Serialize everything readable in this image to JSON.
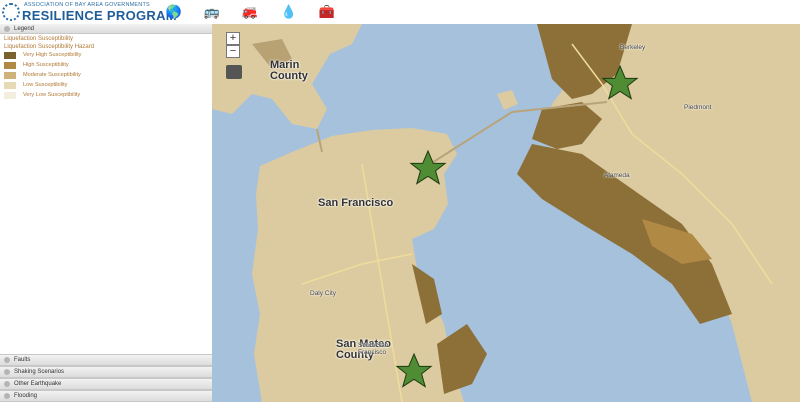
{
  "app": {
    "logo_top": "ASSOCIATION OF BAY AREA GOVERNMENTS",
    "logo_main": "RESILIENCE PROGRAM",
    "tools": [
      {
        "name": "earth-globe-icon",
        "glyph": "🌎"
      },
      {
        "name": "school-bus-icon",
        "glyph": "🚌"
      },
      {
        "name": "fire-truck-icon",
        "glyph": "🚒"
      },
      {
        "name": "water-drop-icon",
        "glyph": "💧"
      },
      {
        "name": "warning-box-icon",
        "glyph": "🧰"
      }
    ]
  },
  "sidebar": {
    "legend_header": "Legend",
    "layer_title": "Liquefaction Susceptibility",
    "layer_subtitle": "Liquefaction Susceptibility Hazard",
    "legend_items": [
      {
        "label": "Very High Susceptibility",
        "color": "#7a6130"
      },
      {
        "label": "High Susceptibility",
        "color": "#b08a45"
      },
      {
        "label": "Moderate Susceptibility",
        "color": "#cdb27a"
      },
      {
        "label": "Low Susceptibility",
        "color": "#e6d9b6"
      },
      {
        "label": "Very Low Susceptibility",
        "color": "#f3eedd"
      }
    ],
    "panels": [
      "Faults",
      "Shaking Scenarios",
      "Other Earthquake",
      "Flooding"
    ]
  },
  "map": {
    "zoom_in": "+",
    "zoom_out": "−",
    "labels": {
      "marin": "Marin\nCounty",
      "sf": "San Francisco",
      "san_mateo": "San Mateo\nCounty",
      "alameda": "Alameda",
      "daly_city": "Daly City",
      "berkeley": "Berkeley",
      "piedmont": "Piedmont",
      "south_sf": "South San\nFrancisco"
    },
    "colors": {
      "water": "#a6c1dc",
      "land": "#dccba0",
      "high_hazard": "#8c7038",
      "marker": "#4f8c34"
    }
  }
}
